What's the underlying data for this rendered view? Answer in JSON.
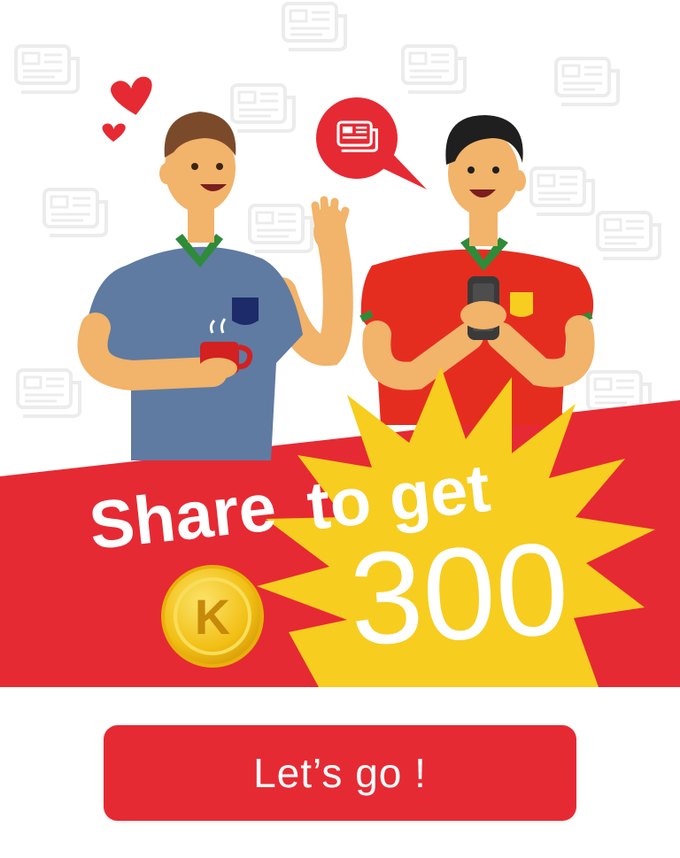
{
  "promo": {
    "headline_share": "Share",
    "headline_to_get": "to get",
    "reward_amount": "300",
    "coin_letter": "K"
  },
  "cta": {
    "label": "Let’s go !"
  },
  "colors": {
    "brand_red": "#e62a33",
    "burst_yellow": "#f7cd1f",
    "coin_gold": "#f3c21b",
    "pattern_grey": "#eeeeee"
  },
  "icons": [
    "newspaper-icon",
    "heart-icon",
    "coin-icon",
    "phone-icon",
    "coffee-mug-icon"
  ]
}
